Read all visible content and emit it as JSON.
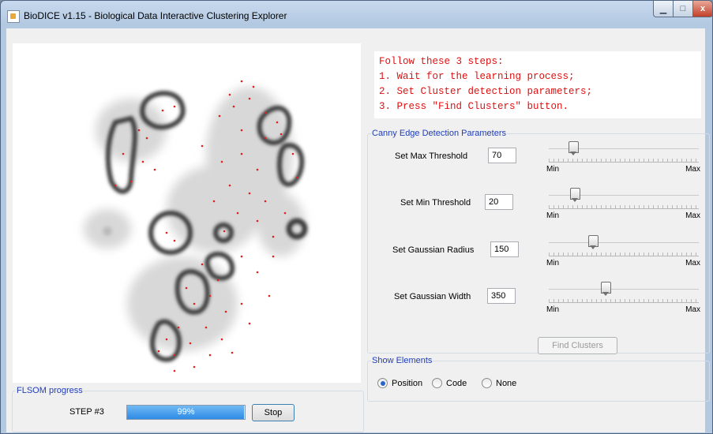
{
  "window": {
    "title": "BioDICE v1.15 - Biological Data Interactive Clustering Explorer",
    "controls": {
      "minimize": "▁",
      "maximize": "□",
      "close": "x"
    }
  },
  "instructions": {
    "lines": [
      "Follow these 3 steps:",
      "1. Wait for the learning process;",
      "2. Set Cluster detection parameters;",
      "3. Press \"Find Clusters\" button."
    ],
    "color": "#e01010"
  },
  "canny": {
    "legend": "Canny Edge Detection Parameters",
    "params": [
      {
        "label": "Set Max Threshold",
        "value": "70",
        "slider_fraction": 0.14,
        "min_label": "Min",
        "max_label": "Max"
      },
      {
        "label": "Set Min Threshold",
        "value": "20",
        "slider_fraction": 0.15,
        "min_label": "Min",
        "max_label": "Max"
      },
      {
        "label": "Set Gaussian Radius",
        "value": "150",
        "slider_fraction": 0.28,
        "min_label": "Min",
        "max_label": "Max"
      },
      {
        "label": "Set Gaussian Width",
        "value": "350",
        "slider_fraction": 0.37,
        "min_label": "Min",
        "max_label": "Max"
      }
    ]
  },
  "find_clusters_label": "Find Clusters",
  "show_elements": {
    "legend": "Show Elements",
    "options": [
      {
        "label": "Position",
        "checked": true
      },
      {
        "label": "Code",
        "checked": false
      },
      {
        "label": "None",
        "checked": false
      }
    ]
  },
  "flsom": {
    "legend": "FLSOM progress",
    "step": "STEP #3",
    "progress_percent": "99%",
    "progress_fraction": 0.99,
    "stop_label": "Stop"
  },
  "colors": {
    "legend": "#1f3db8",
    "progress": "#2d8be6",
    "points": "#e02020"
  }
}
